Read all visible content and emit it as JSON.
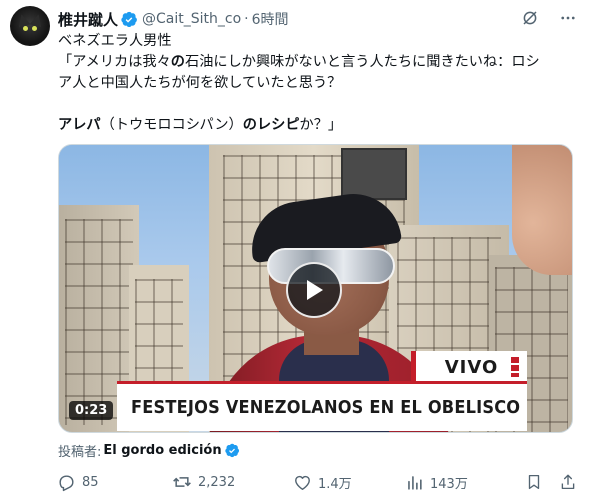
{
  "tweet": {
    "author_name": "椎井蹴人",
    "handle": "@Cait_Sith_co",
    "separator": "·",
    "time": "6時間",
    "text_line1": "ベネズエラ人男性",
    "text_line2_a": "「アメリカは我々",
    "text_line2_bold": "の",
    "text_line2_b": "石油にしか興味がないと言う人たちに聞きたいね：ロシ",
    "text_line3": "ア人と中国人たちが何を欲していたと思う？",
    "text_line4_bold": "アレパ",
    "text_line4_a": "（トウモロコシパン）",
    "text_line4_bold2": "のレシピ",
    "text_line4_b": "か？」"
  },
  "video": {
    "duration": "0:23",
    "live_badge": "VIVO",
    "caption": "FESTEJOS VENEZOLANOS EN EL OBELISCO"
  },
  "attribution": {
    "label": "投稿者:",
    "source": "El gordo edición"
  },
  "actions": {
    "replies": "85",
    "reposts": "2,232",
    "likes": "1.4万",
    "views": "143万"
  },
  "icons": {
    "verified": "verified-badge-icon",
    "grok": "grok-icon",
    "more": "more-icon",
    "reply": "reply-icon",
    "repost": "repost-icon",
    "like": "heart-icon",
    "views": "views-icon",
    "bookmark": "bookmark-icon",
    "share": "share-icon"
  },
  "colors": {
    "accent": "#1d9bf0",
    "text": "#0f1419",
    "muted": "#536471",
    "broadcast_red": "#c41e2a"
  }
}
